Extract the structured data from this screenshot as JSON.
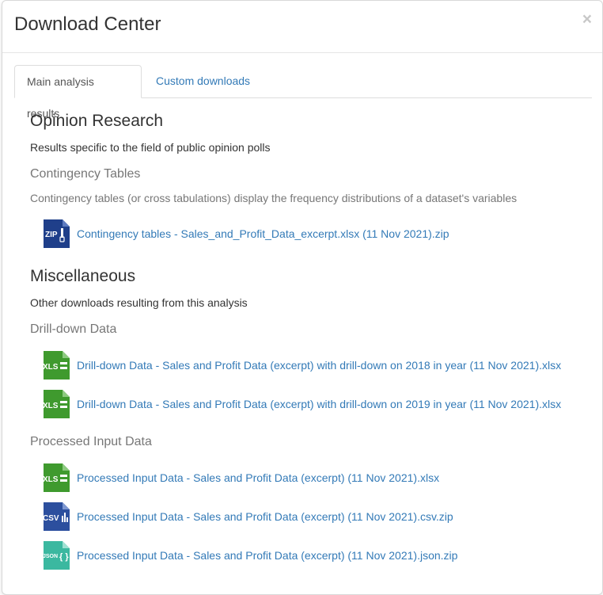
{
  "modal": {
    "title": "Download Center",
    "close_label": "×"
  },
  "tabs": [
    {
      "label": "Main analysis results",
      "active": true
    },
    {
      "label": "Custom downloads",
      "active": false
    }
  ],
  "sections": [
    {
      "title": "Opinion Research",
      "description": "Results specific to the field of public opinion polls",
      "groups": [
        {
          "title": "Contingency Tables",
          "description": "Contingency tables (or cross tabulations) display the frequency distributions of a dataset's variables",
          "files": [
            {
              "icon": "zip-file-icon",
              "badge": "ZIP",
              "label": "Contingency tables - Sales_and_Profit_Data_excerpt.xlsx (11 Nov 2021).zip"
            }
          ]
        }
      ]
    },
    {
      "title": "Miscellaneous",
      "description": "Other downloads resulting from this analysis",
      "groups": [
        {
          "title": "Drill-down Data",
          "files": [
            {
              "icon": "xls-file-icon",
              "badge": "XLS",
              "label": "Drill-down Data - Sales and Profit Data (excerpt) with drill-down on 2018 in year (11 Nov 2021).xlsx"
            },
            {
              "icon": "xls-file-icon",
              "badge": "XLS",
              "label": "Drill-down Data - Sales and Profit Data (excerpt) with drill-down on 2019 in year (11 Nov 2021).xlsx"
            }
          ]
        },
        {
          "title": "Processed Input Data",
          "files": [
            {
              "icon": "xls-file-icon",
              "badge": "XLS",
              "label": "Processed Input Data - Sales and Profit Data (excerpt) (11 Nov 2021).xlsx"
            },
            {
              "icon": "csv-file-icon",
              "badge": "CSV",
              "label": "Processed Input Data - Sales and Profit Data (excerpt) (11 Nov 2021).csv.zip"
            },
            {
              "icon": "json-file-icon",
              "badge": "JSON",
              "label": "Processed Input Data - Sales and Profit Data (excerpt) (11 Nov 2021).json.zip"
            }
          ]
        }
      ]
    }
  ],
  "colors": {
    "link": "#337ab7",
    "zip": "#1f3f8a",
    "xls": "#3f9a2e",
    "csv": "#2c4f9e",
    "json": "#3bb8a0"
  }
}
